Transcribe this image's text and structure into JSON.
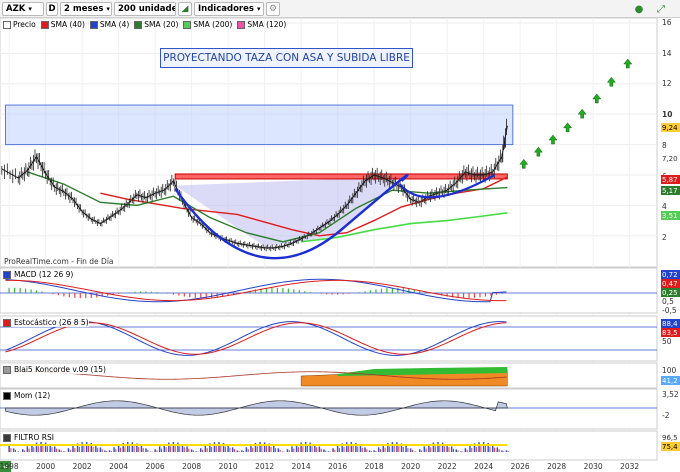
{
  "toolbar": {
    "ticker": "AZK",
    "d_label": "D",
    "period": "2 meses",
    "units": "200 unidades",
    "indicators": "Indicadores",
    "icons": [
      "chart-style-icon",
      "indicators-icon",
      "record-icon",
      "expand-icon"
    ]
  },
  "legend": [
    {
      "label": "Precio",
      "color": "#ffffff"
    },
    {
      "label": "SMA (40)",
      "color": "#e01b1b"
    },
    {
      "label": "SMA (4)",
      "color": "#2244cc"
    },
    {
      "label": "SMA (20)",
      "color": "#2e7d2e"
    },
    {
      "label": "SMA (200)",
      "color": "#55cc55"
    },
    {
      "label": "SMA (120)",
      "color": "#ee55aa"
    }
  ],
  "annotation": "PROYECTANDO TAZA CON ASA Y SUBIDA LIBRE",
  "brand": "ProRealTime.com - Fin de Día",
  "panes": [
    {
      "label": "MACD (12 26 9)",
      "color": "#2244cc"
    },
    {
      "label": "Estocástico (26 8 5)",
      "color": "#e01b1b"
    },
    {
      "label": "Blai5 Koncorde v.09 (15)",
      "color": "#9a9a9a"
    },
    {
      "label": "Mom (12)",
      "color": "#000000"
    },
    {
      "label": "FILTRO RSI",
      "color": "#3a3a3a"
    }
  ],
  "right_axis": {
    "price_ticks": [
      "16",
      "14",
      "12",
      "10",
      "8",
      "6",
      "4",
      "2"
    ],
    "badges": [
      {
        "text": "9,24",
        "color": "#ffcc33",
        "text_color": "#000000"
      },
      {
        "text": "7,20",
        "color": "#ffffff",
        "text_color": "#333333"
      },
      {
        "text": "5,87",
        "color": "#e01b1b",
        "text_color": "#ffffff"
      },
      {
        "text": "5,17",
        "color": "#2e7d2e",
        "text_color": "#ffffff"
      },
      {
        "text": "3,51",
        "color": "#55cc55",
        "text_color": "#ffffff"
      }
    ],
    "macd_badges": [
      {
        "text": "0,72",
        "color": "#2244cc"
      },
      {
        "text": "0,47",
        "color": "#e01b1b"
      },
      {
        "text": "0,25",
        "color": "#2e7d2e"
      }
    ],
    "macd_ticks": [
      "0,5",
      "-0,5"
    ],
    "stoch_ticks": [
      "50"
    ],
    "stoch_badges": [
      {
        "text": "88,4",
        "color": "#2244cc"
      },
      {
        "text": "83,5",
        "color": "#e01b1b"
      }
    ],
    "koncorde_ticks": [
      "100"
    ],
    "koncorde_badges": [
      {
        "text": "41,2",
        "color": "#55aaff"
      }
    ],
    "mom_ticks": [
      "3,52",
      "-2"
    ],
    "rsi_badges": [
      {
        "text": "96,5",
        "color": "#ffffff"
      },
      {
        "text": "75,4",
        "color": "#ffcc33"
      }
    ]
  },
  "x_axis": {
    "years": [
      1998,
      2000,
      2002,
      2004,
      2006,
      2008,
      2010,
      2012,
      2014,
      2016,
      2018,
      2020,
      2022,
      2024,
      2026,
      2028,
      2030,
      2032
    ]
  },
  "chart_data": {
    "type": "line",
    "title": "",
    "xlabel": "",
    "ylabel": "",
    "ylim": [
      0,
      16
    ],
    "x_range": [
      1997.5,
      2033.5
    ],
    "series": [
      {
        "name": "Precio",
        "x": [
          1997.6,
          1998.5,
          1999.0,
          1999.5,
          2000.0,
          2000.5,
          2001.0,
          2001.5,
          2002.0,
          2002.5,
          2003.0,
          2003.5,
          2004.0,
          2004.5,
          2005.0,
          2005.5,
          2006.0,
          2006.5,
          2007.0,
          2007.5,
          2008.0,
          2008.5,
          2009.0,
          2009.5,
          2010.0,
          2010.5,
          2011.0,
          2011.5,
          2012.0,
          2012.5,
          2013.0,
          2013.5,
          2014.0,
          2014.5,
          2015.0,
          2015.5,
          2016.0,
          2016.5,
          2017.0,
          2017.5,
          2018.0,
          2018.5,
          2019.0,
          2019.5,
          2020.0,
          2020.5,
          2021.0,
          2021.5,
          2022.0,
          2022.5,
          2023.0,
          2023.5,
          2024.0,
          2024.5,
          2025.0,
          2025.3
        ],
        "values": [
          6.4,
          5.8,
          6.3,
          7.2,
          6.1,
          5.2,
          4.9,
          4.4,
          3.6,
          3.1,
          2.8,
          3.2,
          3.6,
          4.1,
          4.7,
          4.5,
          4.8,
          5.0,
          5.6,
          4.3,
          3.2,
          2.8,
          2.2,
          1.9,
          1.7,
          1.5,
          1.4,
          1.3,
          1.2,
          1.2,
          1.3,
          1.5,
          1.8,
          2.1,
          2.5,
          2.9,
          3.4,
          4.0,
          4.8,
          5.6,
          6.0,
          5.8,
          5.5,
          5.2,
          4.4,
          4.2,
          4.6,
          4.8,
          5.0,
          5.5,
          6.2,
          6.0,
          6.0,
          6.2,
          7.2,
          9.24
        ]
      },
      {
        "name": "SMA (40)",
        "x": [
          2003.0,
          2004.5,
          2006.0,
          2007.5,
          2009.0,
          2010.5,
          2012.0,
          2013.5,
          2015.0,
          2016.5,
          2018.0,
          2019.5,
          2021.0,
          2022.5,
          2024.0,
          2025.3
        ],
        "values": [
          4.8,
          4.4,
          4.1,
          3.8,
          3.6,
          3.4,
          2.9,
          2.4,
          2.0,
          2.2,
          3.0,
          3.9,
          4.4,
          4.8,
          5.1,
          5.87
        ]
      },
      {
        "name": "SMA (20)",
        "x": [
          1999.0,
          2001.0,
          2003.0,
          2005.0,
          2007.0,
          2009.0,
          2011.0,
          2013.0,
          2015.0,
          2017.0,
          2019.0,
          2021.0,
          2023.0,
          2025.3
        ],
        "values": [
          6.2,
          5.4,
          4.2,
          4.0,
          4.6,
          3.2,
          2.2,
          1.6,
          2.2,
          3.8,
          5.0,
          4.8,
          5.0,
          5.17
        ]
      },
      {
        "name": "SMA (200)",
        "x": [
          2014.0,
          2016.0,
          2018.0,
          2020.0,
          2022.0,
          2024.0,
          2025.3
        ],
        "values": [
          1.6,
          1.9,
          2.4,
          2.8,
          3.0,
          3.3,
          3.51
        ]
      }
    ],
    "annotations": [
      "PROYECTANDO TAZA CON ASA Y SUBIDA LIBRE"
    ],
    "resistance_level": 5.87,
    "last_price": 9.24,
    "grid": true,
    "legend": "top-left"
  }
}
